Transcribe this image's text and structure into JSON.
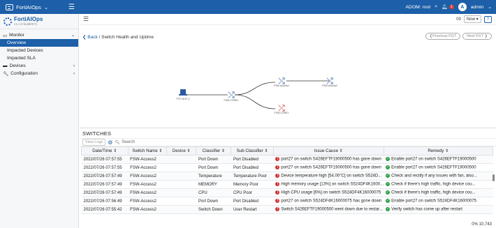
{
  "topbar": {
    "app_name": "FortiAIOps",
    "app_chevron": "⌄",
    "adom": "ADOM: root",
    "notif_count": "1",
    "user": "admin",
    "user_initial": "A"
  },
  "sidebar": {
    "brand_name": "FortiAIOps",
    "brand_version": "v1.1.0-build0071",
    "items": [
      {
        "label": "Monitor"
      },
      {
        "label": "Overview"
      },
      {
        "label": "Impacted Devices"
      },
      {
        "label": "Impacted SLA"
      },
      {
        "label": "Devices"
      },
      {
        "label": "Configuration"
      }
    ]
  },
  "subbar": {
    "refresh_value": "00",
    "refresh_label": "Now"
  },
  "breadcrumb": {
    "back": "Back",
    "path": "/ Switch Health and Uptime"
  },
  "nav": {
    "prev": "Previous FGT",
    "next": "Next FGT"
  },
  "topology": {
    "nodes": [
      {
        "label": "FGT-301F-2"
      },
      {
        "label": "FSW-CORE1"
      },
      {
        "label": "FSW-Access1"
      },
      {
        "label": "FSW-Access2"
      },
      {
        "label": "FSW-CORE1"
      }
    ]
  },
  "switches": {
    "title": "SWITCHES",
    "view_logs": "View Logs",
    "search_placeholder": "Search",
    "columns": [
      "Date/Time ⇕",
      "Switch Name ⇕",
      "Device ⇕",
      "Classifier ⇕",
      "Sub Classifier ⇕",
      "Issue Cause ⇕",
      "Remedy ⇕"
    ],
    "rows": [
      [
        "2022/07/26 07:57:55",
        "FSW-Access2",
        "",
        "Port Down",
        "Port Disabled",
        "port27 on switch S426EFTF19000500 has gone down",
        "Enable port27 on switch S426EFTF19000500"
      ],
      [
        "2022/07/26 07:57:55",
        "FSW-Access2",
        "",
        "Port Down",
        "Port Disabled",
        "port27 on switch S426EFTF19000500 has gone down",
        "Enable port27 on switch S426EFTF19000500"
      ],
      [
        "2022/07/26 07:57:49",
        "FSW-Access2",
        "",
        "Temperature",
        "Temperature Poor",
        "Device temperature high [54.00°C] on switch S524D...",
        "Check and rectify if any issues with fan, also..."
      ],
      [
        "2022/07/26 07:57:49",
        "FSW-Access2",
        "",
        "MEMORY",
        "Memory Poor",
        "High memory usage [13%] on switch S524DF4K1600...",
        "Check if there's high traffic, high device cou..."
      ],
      [
        "2022/07/26 07:57:49",
        "FSW-Access2",
        "",
        "CPU",
        "CPU Poor",
        "High CPU usage [6%] on switch S524DF4K16000075",
        "Check if there's high traffic, high device cou..."
      ],
      [
        "2022/07/26 07:56:49",
        "FSW-Access2",
        "",
        "Port Down",
        "Port Disabled",
        "port27 on switch S524DF4K16000075 has gone down",
        "Enable port27 on switch S524DF4K16000075"
      ],
      [
        "2022/07/26 07:55:42",
        "FSW-Access2",
        "",
        "Switch Down",
        "User Restart",
        "Switch S426EFTF19000500 went down due to restar...",
        "Verify switch has come up after restart"
      ]
    ],
    "footer": "0% 10,743"
  }
}
